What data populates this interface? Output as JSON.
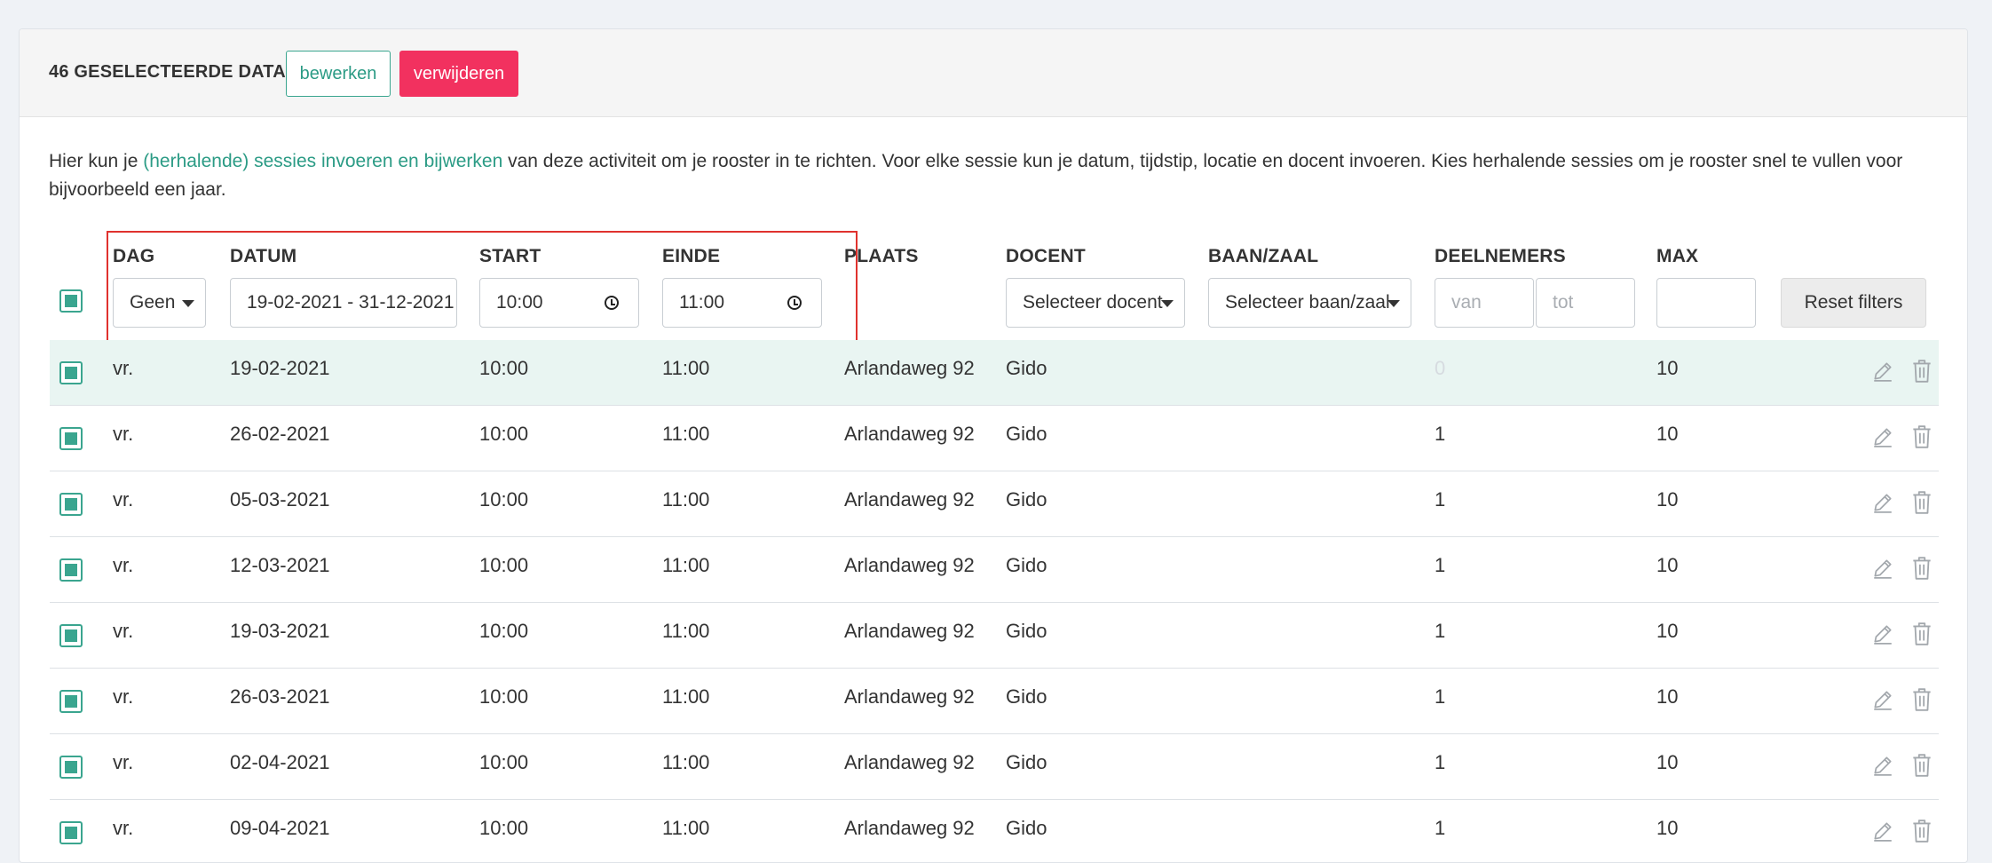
{
  "header": {
    "selection_label": "46 GESELECTEERDE DATA",
    "edit_label": "bewerken",
    "delete_label": "verwijderen"
  },
  "intro": {
    "before": "Hier kun je ",
    "link": "(herhalende) sessies invoeren en bijwerken",
    "after": " van deze activiteit om je rooster in te richten. Voor elke sessie kun je datum, tijdstip, locatie en docent invoeren. Kies herhalende sessies om je rooster snel te vullen voor bijvoorbeeld een jaar."
  },
  "columns": {
    "dag": "DAG",
    "datum": "DATUM",
    "start": "START",
    "einde": "EINDE",
    "plaats": "PLAATS",
    "docent": "DOCENT",
    "baan": "BAAN/ZAAL",
    "deelnemers": "DEELNEMERS",
    "max": "MAX"
  },
  "filters": {
    "dag_value": "Geen",
    "datum_value": "19-02-2021 - 31-12-2021",
    "start_value": "10:00",
    "einde_value": "11:00",
    "docent_placeholder": "Selecteer docent",
    "baan_placeholder": "Selecteer baan/zaal",
    "deelnemers_van_placeholder": "van",
    "deelnemers_tot_placeholder": "tot",
    "max_value": "",
    "reset_label": "Reset filters"
  },
  "colors": {
    "accent": "#3aa58f",
    "danger": "#f2315f",
    "highlight_row": "#e9f5f2",
    "annotation_box": "#e0322e"
  },
  "rows": [
    {
      "dag": "vr.",
      "datum": "19-02-2021",
      "start": "10:00",
      "einde": "11:00",
      "plaats": "Arlandaweg 92",
      "docent": "Gido",
      "deelnemers": "0",
      "max": "10"
    },
    {
      "dag": "vr.",
      "datum": "26-02-2021",
      "start": "10:00",
      "einde": "11:00",
      "plaats": "Arlandaweg 92",
      "docent": "Gido",
      "deelnemers": "1",
      "max": "10"
    },
    {
      "dag": "vr.",
      "datum": "05-03-2021",
      "start": "10:00",
      "einde": "11:00",
      "plaats": "Arlandaweg 92",
      "docent": "Gido",
      "deelnemers": "1",
      "max": "10"
    },
    {
      "dag": "vr.",
      "datum": "12-03-2021",
      "start": "10:00",
      "einde": "11:00",
      "plaats": "Arlandaweg 92",
      "docent": "Gido",
      "deelnemers": "1",
      "max": "10"
    },
    {
      "dag": "vr.",
      "datum": "19-03-2021",
      "start": "10:00",
      "einde": "11:00",
      "plaats": "Arlandaweg 92",
      "docent": "Gido",
      "deelnemers": "1",
      "max": "10"
    },
    {
      "dag": "vr.",
      "datum": "26-03-2021",
      "start": "10:00",
      "einde": "11:00",
      "plaats": "Arlandaweg 92",
      "docent": "Gido",
      "deelnemers": "1",
      "max": "10"
    },
    {
      "dag": "vr.",
      "datum": "02-04-2021",
      "start": "10:00",
      "einde": "11:00",
      "plaats": "Arlandaweg 92",
      "docent": "Gido",
      "deelnemers": "1",
      "max": "10"
    },
    {
      "dag": "vr.",
      "datum": "09-04-2021",
      "start": "10:00",
      "einde": "11:00",
      "plaats": "Arlandaweg 92",
      "docent": "Gido",
      "deelnemers": "1",
      "max": "10"
    }
  ]
}
